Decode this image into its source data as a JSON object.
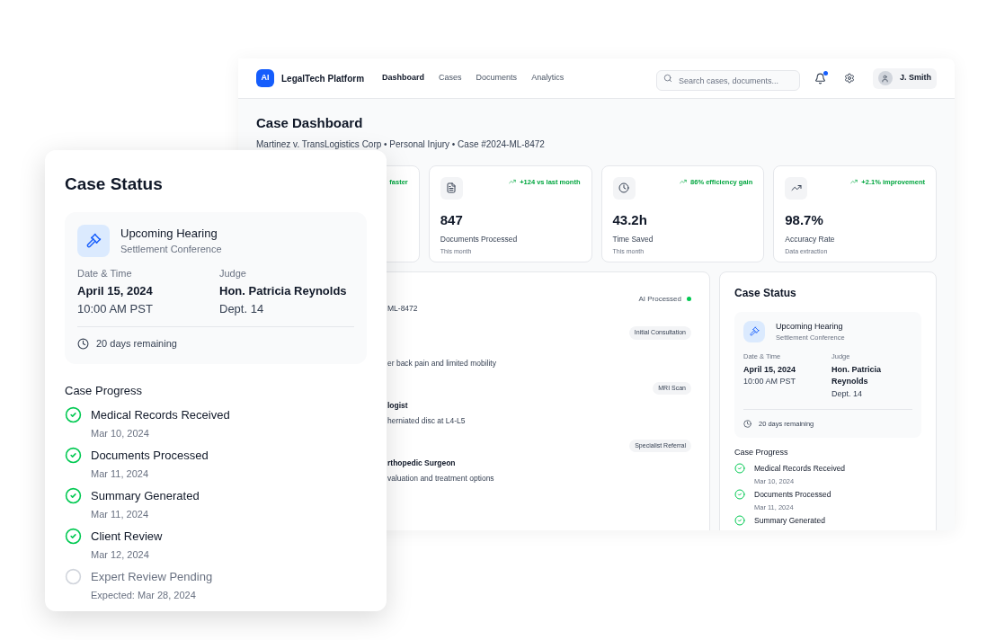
{
  "header": {
    "logo": "AI",
    "brand": "LegalTech Platform",
    "nav": [
      {
        "label": "Dashboard",
        "selected": true
      },
      {
        "label": "Cases",
        "selected": false
      },
      {
        "label": "Documents",
        "selected": false
      },
      {
        "label": "Analytics",
        "selected": false
      }
    ],
    "search": {
      "placeholder": "Search cases, documents..."
    },
    "notification_unread": true,
    "user": "J. Smith"
  },
  "page": {
    "title": "Case Dashboard",
    "subtitle": "Martinez v. TransLogistics Corp • Personal Injury • Case #2024-ML-8472"
  },
  "stats": [
    {
      "trend": "faster"
    },
    {
      "trend": "+124 vs last month",
      "value": "847",
      "label": "Documents Processed",
      "note": "This month"
    },
    {
      "trend": "86% efficiency gain",
      "value": "43.2h",
      "label": "Time Saved",
      "note": "This month"
    },
    {
      "trend": "+2.1% improvement",
      "value": "98.7%",
      "label": "Accuracy Rate",
      "note": "Data extraction"
    }
  ],
  "timeline": {
    "status": "AI Processed",
    "case_ref": "ML-8472",
    "entries": [
      {
        "tag": "Initial Consultation",
        "text": "er back pain and limited mobility"
      },
      {
        "tag": "MRI Scan",
        "title": "logist",
        "text": "herniated disc at L4-L5"
      },
      {
        "tag": "Specialist Referral",
        "title": "rthopedic Surgeon",
        "text": "valuation and treatment options"
      }
    ]
  },
  "side_status": {
    "title": "Case Status",
    "hearing": {
      "title": "Upcoming Hearing",
      "subtitle": "Settlement Conference",
      "date_label": "Date & Time",
      "date": "April 15, 2024",
      "time": "10:00 AM PST",
      "judge_label": "Judge",
      "judge": "Hon. Patricia Reynolds",
      "dept": "Dept. 14",
      "remaining": "20 days remaining"
    },
    "progress_title": "Case Progress",
    "steps": [
      {
        "label": "Medical Records Received",
        "date": "Mar 10, 2024",
        "done": true
      },
      {
        "label": "Documents Processed",
        "date": "Mar 11, 2024",
        "done": true
      },
      {
        "label": "Summary Generated",
        "done": true
      }
    ]
  },
  "overlay_status": {
    "title": "Case Status",
    "hearing": {
      "title": "Upcoming Hearing",
      "subtitle": "Settlement Conference",
      "date_label": "Date & Time",
      "date": "April 15, 2024",
      "time": "10:00 AM PST",
      "judge_label": "Judge",
      "judge": "Hon. Patricia Reynolds",
      "dept": "Dept. 14",
      "remaining": "20 days remaining"
    },
    "progress_title": "Case Progress",
    "steps": [
      {
        "label": "Medical Records Received",
        "date": "Mar 10, 2024",
        "done": true
      },
      {
        "label": "Documents Processed",
        "date": "Mar 11, 2024",
        "done": true
      },
      {
        "label": "Summary Generated",
        "date": "Mar 11, 2024",
        "done": true
      },
      {
        "label": "Client Review",
        "date": "Mar 12, 2024",
        "done": true
      },
      {
        "label": "Expert Review Pending",
        "date": "Expected: Mar 28, 2024",
        "done": false
      }
    ]
  }
}
